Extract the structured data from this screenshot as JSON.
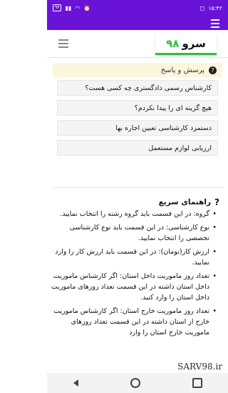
{
  "status": {
    "time": "۱۵:۴۲",
    "battery": "۹۴"
  },
  "brand": {
    "name_a": "سرو",
    "name_b": "۹۸"
  },
  "faq": {
    "title": "پرسش و پاسخ",
    "items": [
      "کارشناس رسمی دادگستری چه کسی هست؟",
      "هیچ گزینه ای را پیدا نکردم؟",
      "دستمزد کارشناسی تعیین اجاره بها",
      "ارزیابی لوازم مستعمل"
    ]
  },
  "guide": {
    "title": "راهنمای سریع",
    "items": [
      "گروه: در این قسمت باید گروه رشته را انتخاب نمایید.",
      "نوع کارشناسی: در این قسمت باید نوع کارشناسی تخصصی را انتخاب نمایید.",
      "ارزش کار(تومان): در این قسمت باید ارزش کار را وارد نمایید.",
      "تعداد روز ماموریت داخل استان: اگر کارشناس ماموریت داخل استان داشته در این قسمت تعداد روزهای ماموریت داخل استان را وارد کنید.",
      "تعداد روز ماموریت خارج استان: اگر کارشناس ماموریت خارج از استان داشته در این قسمت تعداد روزهای ماموریت خارج استان را وارد"
    ]
  },
  "watermark": "SARV98.ir"
}
